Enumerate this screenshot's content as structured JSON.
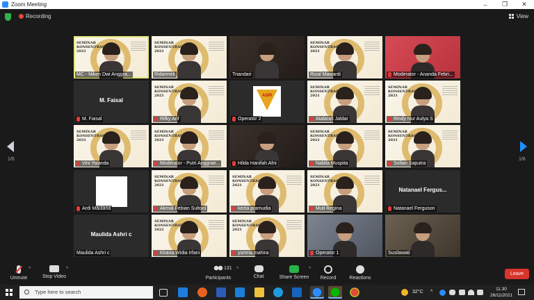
{
  "window": {
    "title": "Zoom Meeting",
    "controls": [
      "–",
      "❐",
      "✕"
    ]
  },
  "topbar": {
    "recording_label": "Recording",
    "view_label": "View"
  },
  "pager": {
    "left": "1/6",
    "right": "1/6"
  },
  "poster": {
    "line1": "SEMINAR",
    "line2": "KONSENTRASI",
    "line3": "2021"
  },
  "aspi_text": "ASPI",
  "participants": [
    {
      "name": "MC - Niken Dwi Anggra...",
      "kind": "video",
      "active": true,
      "muted": false
    },
    {
      "name": "Ridarmeli",
      "kind": "video",
      "active": false,
      "muted": false
    },
    {
      "name": "Triandari",
      "kind": "dim",
      "active": false,
      "muted": false
    },
    {
      "name": "Rizal Mawardi",
      "kind": "video",
      "active": false,
      "muted": false
    },
    {
      "name": "Moderator - Ananda Febri...",
      "kind": "pink",
      "active": false,
      "muted": true
    },
    {
      "name": "M. Faisal",
      "kind": "name",
      "big": "M. Faisal",
      "active": false,
      "muted": true
    },
    {
      "name": "Rifky Arif",
      "kind": "video",
      "active": false,
      "muted": true
    },
    {
      "name": "Operator 2",
      "kind": "aspi",
      "active": false,
      "muted": true
    },
    {
      "name": "Atalarafi Jaldar",
      "kind": "video",
      "active": false,
      "muted": true
    },
    {
      "name": "Rindy Nur Aulya S",
      "kind": "video",
      "active": false,
      "muted": true
    },
    {
      "name": "Vini Yolanda",
      "kind": "video",
      "active": false,
      "muted": true
    },
    {
      "name": "Moderator - Putri Anggrae...",
      "kind": "video",
      "active": false,
      "muted": true
    },
    {
      "name": "Hilda Hanifah Afni",
      "kind": "dim",
      "active": false,
      "muted": true
    },
    {
      "name": "Nabila Muspita",
      "kind": "video",
      "active": false,
      "muted": true
    },
    {
      "name": "Sofian Saputra",
      "kind": "video",
      "active": false,
      "muted": true
    },
    {
      "name": "Ardi Maulana",
      "kind": "white",
      "active": false,
      "muted": true
    },
    {
      "name": "Akmal Febian Sultoni",
      "kind": "video",
      "active": false,
      "muted": true
    },
    {
      "name": "keziа pramudia",
      "kind": "video",
      "active": false,
      "muted": true
    },
    {
      "name": "Muti Regina",
      "kind": "video",
      "active": false,
      "muted": true
    },
    {
      "name": "Natanael Ferguson",
      "kind": "name",
      "big": "Natanael Fergus...",
      "active": false,
      "muted": true
    },
    {
      "name": "Maulida Ashri c",
      "kind": "name",
      "big": "Maulida Ashri c",
      "active": false,
      "muted": false
    },
    {
      "name": "Kirana Widia Irfani",
      "kind": "video",
      "active": false,
      "muted": true
    },
    {
      "name": "yumna mahira",
      "kind": "video",
      "active": false,
      "muted": true
    },
    {
      "name": "Operator 1",
      "kind": "room",
      "active": false,
      "muted": true
    },
    {
      "name": "Susilawati",
      "kind": "room2",
      "active": false,
      "muted": false
    }
  ],
  "toolbar": {
    "unmute": "Unmute",
    "stop_video": "Stop Video",
    "participants": "Participants",
    "participants_count": "131",
    "chat": "Chat",
    "share_screen": "Share Screen",
    "record": "Record",
    "reactions": "Reactions",
    "leave": "Leave"
  },
  "taskbar": {
    "search_placeholder": "Type here to search",
    "temperature": "32°C",
    "time": "11.30",
    "date": "26/11/2021"
  }
}
